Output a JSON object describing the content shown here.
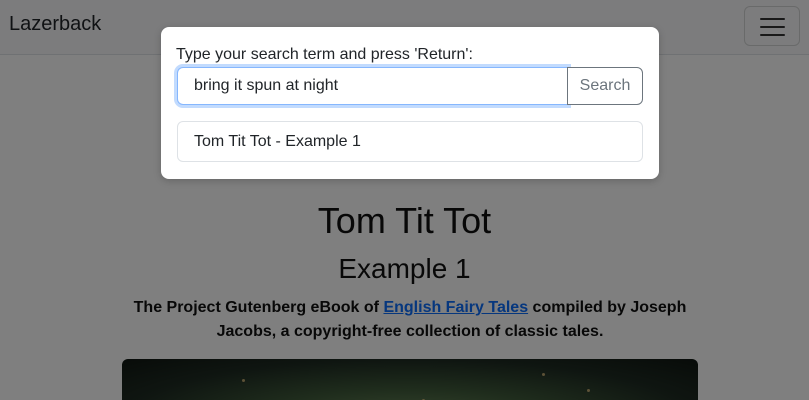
{
  "navbar": {
    "brand": "Lazerback",
    "toggler_icon": "hamburger-menu-icon"
  },
  "page": {
    "title": "Tom Tit Tot",
    "subtitle": "Example 1",
    "desc_prefix": "The Project Gutenberg eBook of ",
    "desc_link": "English Fairy Tales",
    "desc_suffix": " compiled by Joseph Jacobs, a copyright-free collection of classic tales."
  },
  "search_modal": {
    "label": "Type your search term and press 'Return':",
    "input_value": "bring it spun at night",
    "button_label": "Search",
    "results": [
      "Tom Tit Tot - Example 1"
    ]
  },
  "colors": {
    "link": "#0d6efd",
    "backdrop": "#000000",
    "focus_ring": "#86b7fe"
  }
}
